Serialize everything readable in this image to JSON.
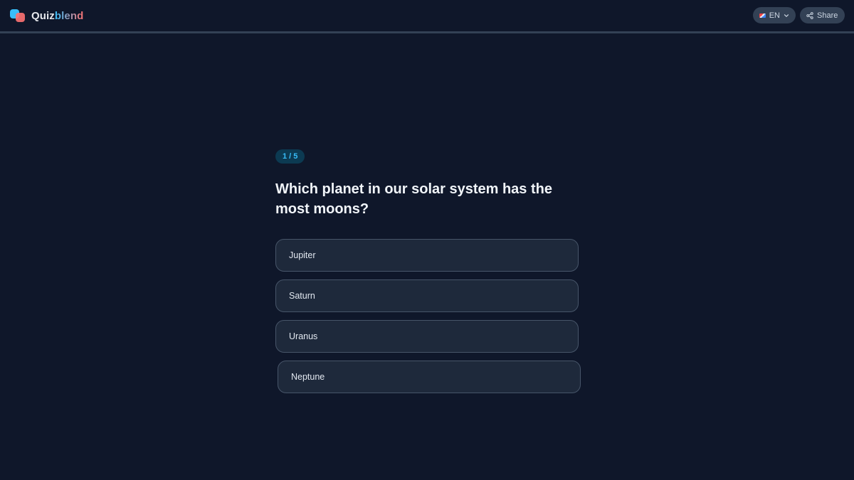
{
  "header": {
    "brand_part1": "Quiz",
    "brand_part2": "blend",
    "language_label": "EN",
    "share_label": "Share"
  },
  "quiz": {
    "progress_label": "1 / 5",
    "question": "Which planet in our solar system has the most moons?",
    "options": [
      {
        "label": "Jupiter"
      },
      {
        "label": "Saturn"
      },
      {
        "label": "Uranus"
      },
      {
        "label": "Neptune"
      }
    ]
  },
  "icons": {
    "logo": "logo-icon",
    "flag": "uk-flag-icon",
    "chevron": "chevron-down-icon",
    "share": "share-icon"
  },
  "colors": {
    "background": "#0f172a",
    "accent": "#38bdf8",
    "accent_secondary": "#f87171",
    "option_bg": "#1e293b",
    "option_border": "#475569"
  }
}
